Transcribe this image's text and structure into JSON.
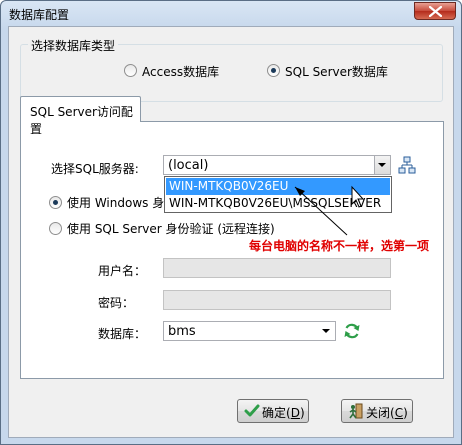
{
  "window": {
    "title": "数据库配置"
  },
  "db_type": {
    "group_label": "选择数据库类型",
    "options": [
      {
        "label": "Access数据库",
        "checked": false
      },
      {
        "label": "SQL Server数据库",
        "checked": true
      }
    ]
  },
  "tab": {
    "label": "SQL Server访问配置"
  },
  "server": {
    "label": "选择SQL服务器:",
    "value": "(local)",
    "dropdown_items": [
      "WIN-MTKQB0V26EU",
      "WIN-MTKQB0V26EU\\MSSQLSERVER"
    ]
  },
  "auth": {
    "windows_label": "使用 Windows 身份",
    "sqlserver_label": "使用 SQL Server 身份验证 (远程连接)"
  },
  "annotation": "每台电脑的名称不一样，选第一项",
  "fields": {
    "username_label": "用户名：",
    "password_label": "密码：",
    "database_label": "数据库：",
    "database_value": "bms"
  },
  "buttons": {
    "ok_text": "确定(",
    "ok_key": "D",
    "close_text": "关闭(",
    "close_key": "C",
    "paren": ")"
  },
  "colors": {
    "annotation": "#e00000",
    "selection": "#3399ff",
    "accent_green": "#2e9e49"
  }
}
